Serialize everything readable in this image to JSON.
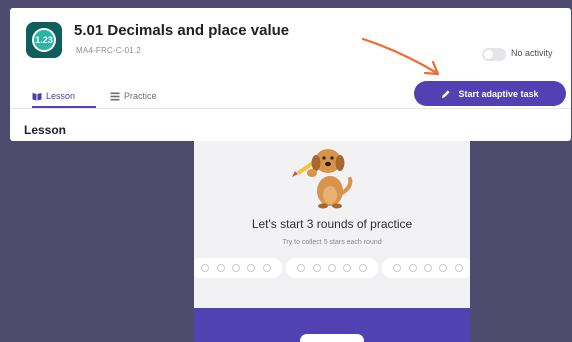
{
  "lesson": {
    "logo_text": "1.23",
    "title": "5.01 Decimals and place value",
    "code": "MA4-FRC-C-01.2",
    "activity_label": "No activity",
    "tabs": [
      {
        "label": "Lesson",
        "icon": "book-icon",
        "active": true
      },
      {
        "label": "Practice",
        "icon": "list-icon",
        "active": false
      }
    ],
    "start_button_label": "Start adaptive task",
    "section_heading": "Lesson"
  },
  "practice": {
    "title": "Let's start 3 rounds of practice",
    "subtitle": "Try to collect 5 stars each round",
    "rounds": 3,
    "stars_per_round": 5,
    "footer_button_label": ""
  },
  "colors": {
    "background": "#4f4b6e",
    "brand_purple": "#5241b3",
    "logo_teal": "#0e5e5e",
    "arrow_orange": "#f26a2e"
  }
}
